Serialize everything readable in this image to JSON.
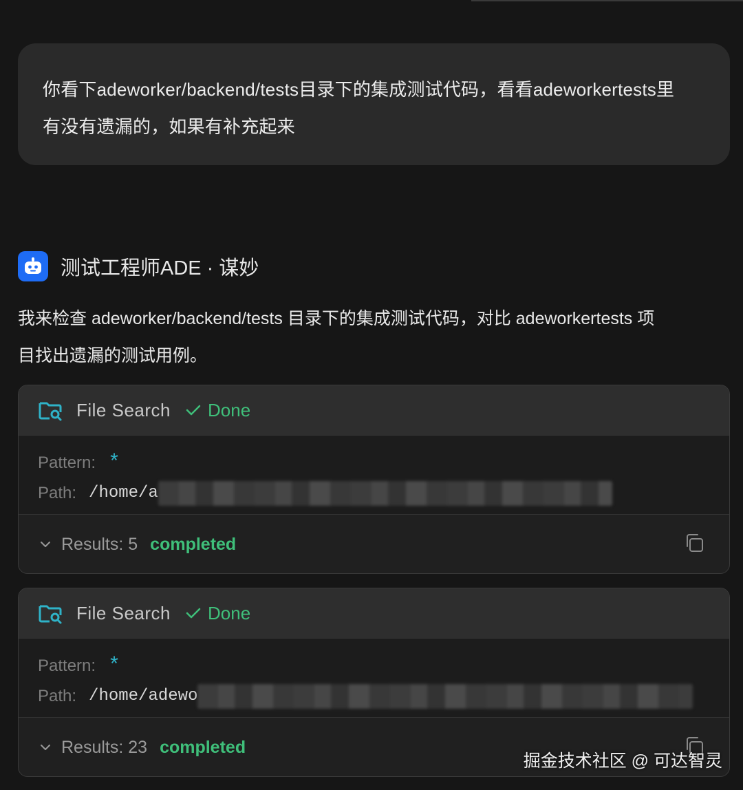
{
  "user_message": {
    "line1": "你看下adeworker/backend/tests目录下的集成测试代码，看看adeworkertests里",
    "line2": "有没有遗漏的，如果有补充起来"
  },
  "agent": {
    "avatar_icon": "robot-icon",
    "name": "测试工程师ADE · 谋妙",
    "message_line1": "我来检查 adeworker/backend/tests 目录下的集成测试代码，对比 adeworkertests 项",
    "message_line2": "目找出遗漏的测试用例。"
  },
  "tool_cards": [
    {
      "tool": "File Search",
      "status": "Done",
      "pattern_label": "Pattern:",
      "pattern": "*",
      "path_label": "Path:",
      "path": "/home/a",
      "results": "Results: 5",
      "state": "completed"
    },
    {
      "tool": "File Search",
      "status": "Done",
      "pattern_label": "Pattern:",
      "pattern": "*",
      "path_label": "Path:",
      "path": "/home/adewo",
      "results": "Results: 23",
      "state": "completed"
    }
  ],
  "watermark": "掘金技术社区 @ 可达智灵",
  "colors": {
    "background": "#161616",
    "success": "#3fbf7a",
    "accent_cyan": "#2fb3c8",
    "avatar_blue": "#1e6cf5"
  }
}
